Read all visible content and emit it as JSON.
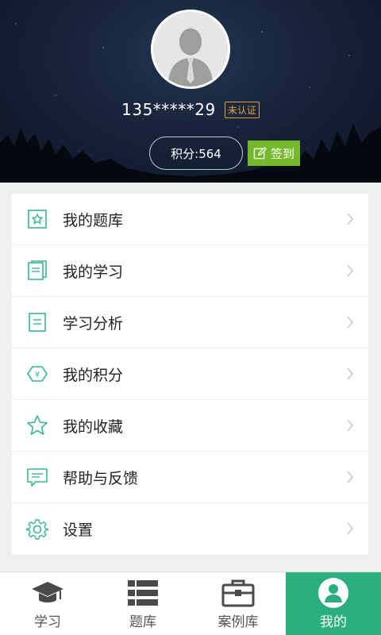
{
  "profile": {
    "phone": "135*****29",
    "verify_badge": "未认证",
    "points_label": "积分:564",
    "checkin_label": "签到"
  },
  "menu": {
    "items": [
      {
        "label": "我的题库",
        "icon": "star-square-icon"
      },
      {
        "label": "我的学习",
        "icon": "notebook-icon"
      },
      {
        "label": "学习分析",
        "icon": "clipboard-icon"
      },
      {
        "label": "我的积分",
        "icon": "yen-hexagon-icon"
      },
      {
        "label": "我的收藏",
        "icon": "star-icon"
      },
      {
        "label": "帮助与反馈",
        "icon": "chat-bubble-icon"
      },
      {
        "label": "设置",
        "icon": "gear-icon"
      }
    ]
  },
  "tabs": [
    {
      "label": "学习",
      "icon": "graduation-cap-icon",
      "active": false
    },
    {
      "label": "题库",
      "icon": "list-icon",
      "active": false
    },
    {
      "label": "案例库",
      "icon": "briefcase-icon",
      "active": false
    },
    {
      "label": "我的",
      "icon": "user-icon",
      "active": true
    }
  ],
  "colors": {
    "accent": "#2ab07e",
    "icon_green": "#37b889",
    "checkin_green": "#74b92a",
    "badge_orange": "#e0a030"
  }
}
